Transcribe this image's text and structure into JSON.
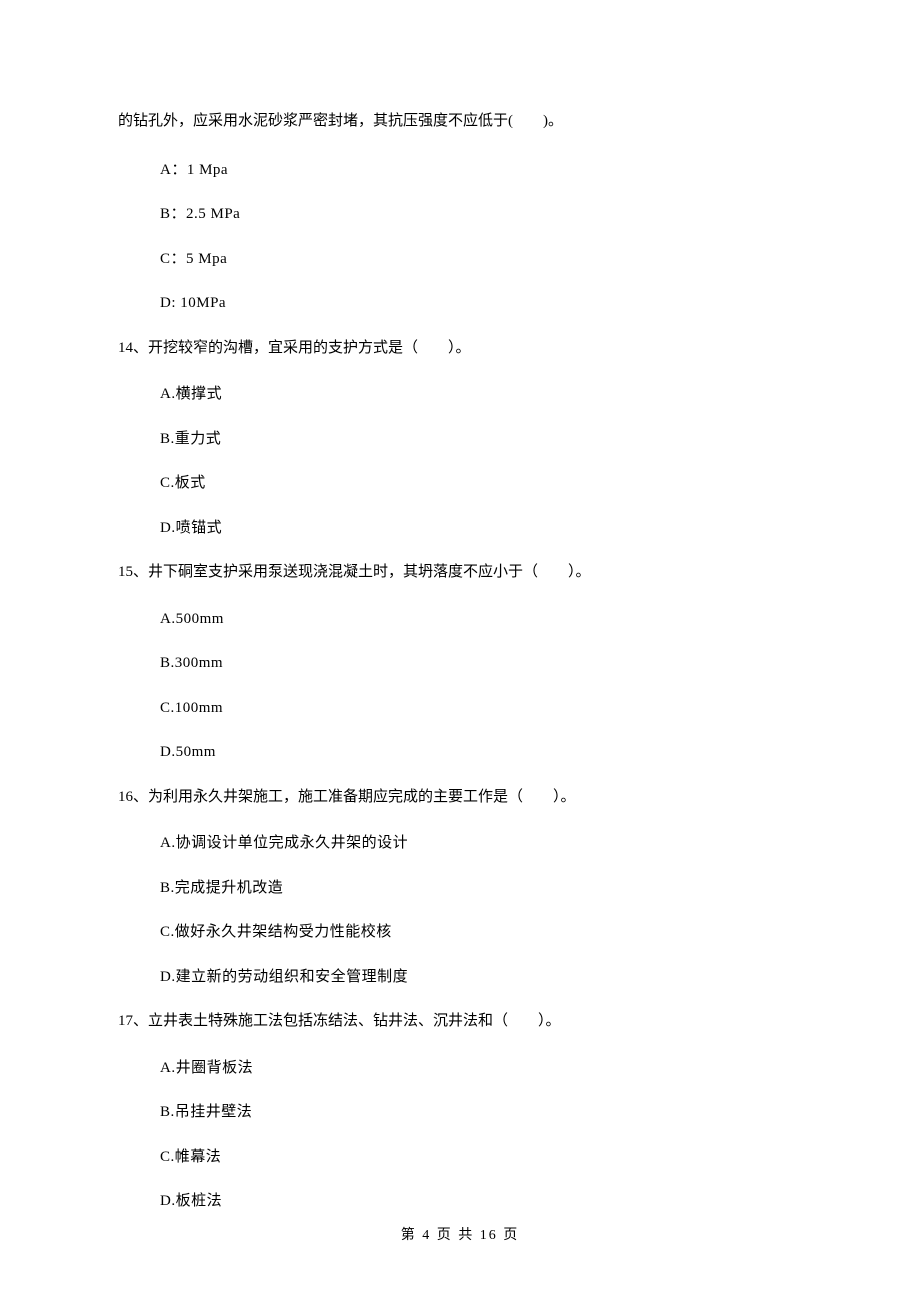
{
  "intro_continuation": "的钻孔外，应采用水泥砂浆严密封堵，其抗压强度不应低于(　　)。",
  "q13_options": {
    "a": "A：1 Mpa",
    "b": "B：2.5 MPa",
    "c": "C：5 Mpa",
    "d": "D: 10MPa"
  },
  "q14": {
    "stem": "14、开挖较窄的沟槽，宜采用的支护方式是（　　）。",
    "a": "A.横撑式",
    "b": "B.重力式",
    "c": "C.板式",
    "d": "D.喷锚式"
  },
  "q15": {
    "stem": "15、井下硐室支护采用泵送现浇混凝土时，其坍落度不应小于（　　）。",
    "a": "A.500mm",
    "b": "B.300mm",
    "c": "C.100mm",
    "d": "D.50mm"
  },
  "q16": {
    "stem": "16、为利用永久井架施工，施工准备期应完成的主要工作是（　　）。",
    "a": "A.协调设计单位完成永久井架的设计",
    "b": "B.完成提升机改造",
    "c": "C.做好永久井架结构受力性能校核",
    "d": "D.建立新的劳动组织和安全管理制度"
  },
  "q17": {
    "stem": "17、立井表土特殊施工法包括冻结法、钻井法、沉井法和（　　）。",
    "a": "A.井圈背板法",
    "b": "B.吊挂井壁法",
    "c": "C.帷幕法",
    "d": "D.板桩法"
  },
  "footer": "第 4 页 共 16 页"
}
